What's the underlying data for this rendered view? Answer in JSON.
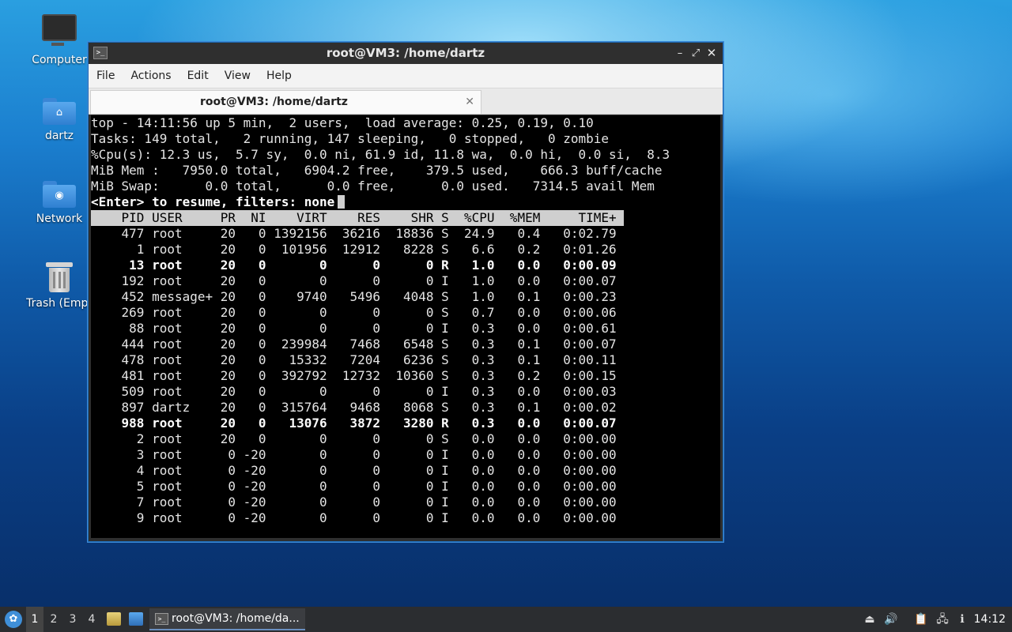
{
  "desktop": {
    "icons": [
      {
        "label": "Computer"
      },
      {
        "label": "dartz"
      },
      {
        "label": "Network"
      },
      {
        "label": "Trash (Empt"
      }
    ]
  },
  "window": {
    "title": "root@VM3: /home/dartz",
    "menu": [
      "File",
      "Actions",
      "Edit",
      "View",
      "Help"
    ],
    "tab_label": "root@VM3: /home/dartz"
  },
  "terminal": {
    "summary": [
      "top - 14:11:56 up 5 min,  2 users,  load average: 0.25, 0.19, 0.10",
      "Tasks: 149 total,   2 running, 147 sleeping,   0 stopped,   0 zombie",
      "%Cpu(s): 12.3 us,  5.7 sy,  0.0 ni, 61.9 id, 11.8 wa,  0.0 hi,  0.0 si,  8.3",
      "MiB Mem :   7950.0 total,   6904.2 free,    379.5 used,    666.3 buff/cache",
      "MiB Swap:      0.0 total,      0.0 free,      0.0 used.   7314.5 avail Mem"
    ],
    "prompt": "<Enter> to resume, filters: none",
    "header": [
      "PID",
      "USER",
      "PR",
      "NI",
      "VIRT",
      "RES",
      "SHR",
      "S",
      "%CPU",
      "%MEM",
      "TIME+"
    ],
    "processes": [
      {
        "pid": "477",
        "user": "root",
        "pr": "20",
        "ni": "0",
        "virt": "1392156",
        "res": "36216",
        "shr": "18836",
        "s": "S",
        "cpu": "24.9",
        "mem": "0.4",
        "time": "0:02.79",
        "bold": false
      },
      {
        "pid": "1",
        "user": "root",
        "pr": "20",
        "ni": "0",
        "virt": "101956",
        "res": "12912",
        "shr": "8228",
        "s": "S",
        "cpu": "6.6",
        "mem": "0.2",
        "time": "0:01.26",
        "bold": false
      },
      {
        "pid": "13",
        "user": "root",
        "pr": "20",
        "ni": "0",
        "virt": "0",
        "res": "0",
        "shr": "0",
        "s": "R",
        "cpu": "1.0",
        "mem": "0.0",
        "time": "0:00.09",
        "bold": true
      },
      {
        "pid": "192",
        "user": "root",
        "pr": "20",
        "ni": "0",
        "virt": "0",
        "res": "0",
        "shr": "0",
        "s": "I",
        "cpu": "1.0",
        "mem": "0.0",
        "time": "0:00.07",
        "bold": false
      },
      {
        "pid": "452",
        "user": "message+",
        "pr": "20",
        "ni": "0",
        "virt": "9740",
        "res": "5496",
        "shr": "4048",
        "s": "S",
        "cpu": "1.0",
        "mem": "0.1",
        "time": "0:00.23",
        "bold": false
      },
      {
        "pid": "269",
        "user": "root",
        "pr": "20",
        "ni": "0",
        "virt": "0",
        "res": "0",
        "shr": "0",
        "s": "S",
        "cpu": "0.7",
        "mem": "0.0",
        "time": "0:00.06",
        "bold": false
      },
      {
        "pid": "88",
        "user": "root",
        "pr": "20",
        "ni": "0",
        "virt": "0",
        "res": "0",
        "shr": "0",
        "s": "I",
        "cpu": "0.3",
        "mem": "0.0",
        "time": "0:00.61",
        "bold": false
      },
      {
        "pid": "444",
        "user": "root",
        "pr": "20",
        "ni": "0",
        "virt": "239984",
        "res": "7468",
        "shr": "6548",
        "s": "S",
        "cpu": "0.3",
        "mem": "0.1",
        "time": "0:00.07",
        "bold": false
      },
      {
        "pid": "478",
        "user": "root",
        "pr": "20",
        "ni": "0",
        "virt": "15332",
        "res": "7204",
        "shr": "6236",
        "s": "S",
        "cpu": "0.3",
        "mem": "0.1",
        "time": "0:00.11",
        "bold": false
      },
      {
        "pid": "481",
        "user": "root",
        "pr": "20",
        "ni": "0",
        "virt": "392792",
        "res": "12732",
        "shr": "10360",
        "s": "S",
        "cpu": "0.3",
        "mem": "0.2",
        "time": "0:00.15",
        "bold": false
      },
      {
        "pid": "509",
        "user": "root",
        "pr": "20",
        "ni": "0",
        "virt": "0",
        "res": "0",
        "shr": "0",
        "s": "I",
        "cpu": "0.3",
        "mem": "0.0",
        "time": "0:00.03",
        "bold": false
      },
      {
        "pid": "897",
        "user": "dartz",
        "pr": "20",
        "ni": "0",
        "virt": "315764",
        "res": "9468",
        "shr": "8068",
        "s": "S",
        "cpu": "0.3",
        "mem": "0.1",
        "time": "0:00.02",
        "bold": false
      },
      {
        "pid": "988",
        "user": "root",
        "pr": "20",
        "ni": "0",
        "virt": "13076",
        "res": "3872",
        "shr": "3280",
        "s": "R",
        "cpu": "0.3",
        "mem": "0.0",
        "time": "0:00.07",
        "bold": true
      },
      {
        "pid": "2",
        "user": "root",
        "pr": "20",
        "ni": "0",
        "virt": "0",
        "res": "0",
        "shr": "0",
        "s": "S",
        "cpu": "0.0",
        "mem": "0.0",
        "time": "0:00.00",
        "bold": false
      },
      {
        "pid": "3",
        "user": "root",
        "pr": "0",
        "ni": "-20",
        "virt": "0",
        "res": "0",
        "shr": "0",
        "s": "I",
        "cpu": "0.0",
        "mem": "0.0",
        "time": "0:00.00",
        "bold": false
      },
      {
        "pid": "4",
        "user": "root",
        "pr": "0",
        "ni": "-20",
        "virt": "0",
        "res": "0",
        "shr": "0",
        "s": "I",
        "cpu": "0.0",
        "mem": "0.0",
        "time": "0:00.00",
        "bold": false
      },
      {
        "pid": "5",
        "user": "root",
        "pr": "0",
        "ni": "-20",
        "virt": "0",
        "res": "0",
        "shr": "0",
        "s": "I",
        "cpu": "0.0",
        "mem": "0.0",
        "time": "0:00.00",
        "bold": false
      },
      {
        "pid": "7",
        "user": "root",
        "pr": "0",
        "ni": "-20",
        "virt": "0",
        "res": "0",
        "shr": "0",
        "s": "I",
        "cpu": "0.0",
        "mem": "0.0",
        "time": "0:00.00",
        "bold": false
      },
      {
        "pid": "9",
        "user": "root",
        "pr": "0",
        "ni": "-20",
        "virt": "0",
        "res": "0",
        "shr": "0",
        "s": "I",
        "cpu": "0.0",
        "mem": "0.0",
        "time": "0:00.00",
        "bold": false
      }
    ]
  },
  "taskbar": {
    "workspaces": [
      "1",
      "2",
      "3",
      "4"
    ],
    "task_label": "root@VM3: /home/da...",
    "clock": "14:12"
  }
}
